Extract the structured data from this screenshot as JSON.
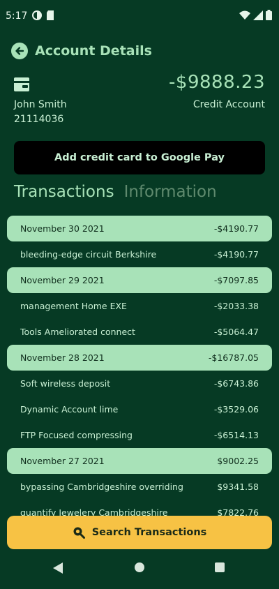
{
  "status": {
    "time": "5:17"
  },
  "header": {
    "title": "Account Details"
  },
  "account": {
    "balance": "-$9888.23",
    "holder_name": "John Smith",
    "type": "Credit Account",
    "number": "21114036"
  },
  "gpay_button": {
    "label": "Add credit card to Google Pay"
  },
  "tabs": [
    {
      "label": "Transactions",
      "active": true
    },
    {
      "label": "Information",
      "active": false
    }
  ],
  "transactions": [
    {
      "kind": "date",
      "label": "November 30 2021",
      "amount": "-$4190.77"
    },
    {
      "kind": "item",
      "label": "bleeding-edge circuit Berkshire",
      "amount": "-$4190.77"
    },
    {
      "kind": "date",
      "label": "November 29 2021",
      "amount": "-$7097.85"
    },
    {
      "kind": "item",
      "label": "management Home EXE",
      "amount": "-$2033.38"
    },
    {
      "kind": "item",
      "label": "Tools Ameliorated connect",
      "amount": "-$5064.47"
    },
    {
      "kind": "date",
      "label": "November 28 2021",
      "amount": "-$16787.05"
    },
    {
      "kind": "item",
      "label": "Soft wireless deposit",
      "amount": "-$6743.86"
    },
    {
      "kind": "item",
      "label": "Dynamic Account lime",
      "amount": "-$3529.06"
    },
    {
      "kind": "item",
      "label": "FTP Focused compressing",
      "amount": "-$6514.13"
    },
    {
      "kind": "date",
      "label": "November 27 2021",
      "amount": "$9002.25"
    },
    {
      "kind": "item",
      "label": "bypassing Cambridgeshire overriding",
      "amount": "$9341.58"
    },
    {
      "kind": "item",
      "label": "quantify Jewelery Cambridgeshire",
      "amount": "$7822.76"
    }
  ],
  "search_button": {
    "label": "Search Transactions"
  },
  "icons": {
    "back": "arrow-left-circle-icon",
    "account": "wallet-icon",
    "search": "search-icon"
  },
  "colors": {
    "background": "#063a24",
    "accent": "#a8e2b8",
    "search_button": "#f7c244",
    "gpay_button": "#000000"
  }
}
